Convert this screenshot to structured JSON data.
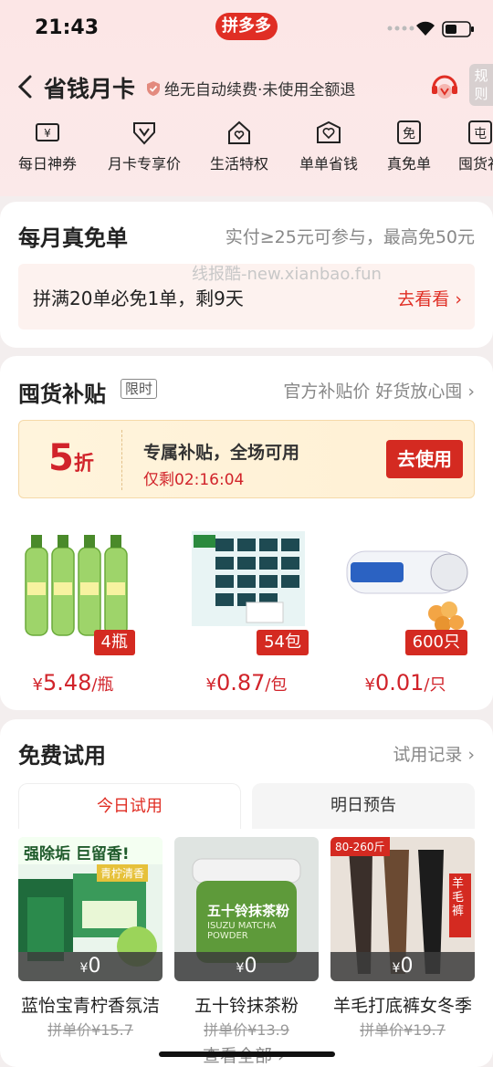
{
  "status": {
    "time": "21:43",
    "app_logo": "拼多多"
  },
  "topbar": {
    "title": "省钱月卡",
    "guarantee": "绝无自动续费·未使用全额退",
    "rules": "规则"
  },
  "benefits": [
    {
      "label": "每日神券",
      "icon": "yen-ticket-icon"
    },
    {
      "label": "月卡专享价",
      "icon": "v-shield-icon"
    },
    {
      "label": "生活特权",
      "icon": "house-heart-icon"
    },
    {
      "label": "单单省钱",
      "icon": "heart-box-icon"
    },
    {
      "label": "真免单",
      "icon": "free-icon",
      "icon_char": "免"
    },
    {
      "label": "囤货补",
      "icon": "stock-icon",
      "icon_char": "屯"
    }
  ],
  "free_order": {
    "title": "每月真免单",
    "rule": "实付≥25元可参与，最高免50元",
    "progress": "拼满20单必免1单，剩9天",
    "link": "去看看",
    "watermark": "线报酷-new.xianbao.fun"
  },
  "stock": {
    "title": "囤货补贴",
    "tag": "限时",
    "right": "官方补贴价 好货放心囤",
    "coupon": {
      "num": "5",
      "unit": "折",
      "title": "专属补贴，全场可用",
      "timer": "仅剩02:16:04",
      "button": "去使用"
    },
    "products": [
      {
        "badge": "4瓶",
        "yen": "¥",
        "price": "5.48",
        "unit": "/瓶"
      },
      {
        "badge": "54包",
        "yen": "¥",
        "price": "0.87",
        "unit": "/包"
      },
      {
        "badge": "600只",
        "yen": "¥",
        "price": "0.01",
        "unit": "/只"
      }
    ]
  },
  "trial": {
    "title": "免费试用",
    "record": "试用记录",
    "tabs": [
      "今日试用",
      "明日预告"
    ],
    "items": [
      {
        "name": "蓝怡宝青柠香氛洁",
        "yen": "¥",
        "zero": "0",
        "was": "拼单价¥15.7",
        "img_text": "强除垢 巨留香!",
        "img_sub": "青柠清香"
      },
      {
        "name": "五十铃抹茶粉",
        "yen": "¥",
        "zero": "0",
        "was": "拼单价¥13.9",
        "img_text": "五十铃抹茶粉",
        "img_sub": "ISUZU MATCHA POWDER"
      },
      {
        "name": "羊毛打底裤女冬季",
        "yen": "¥",
        "zero": "0",
        "was": "拼单价¥19.7",
        "img_text": "80-260斤",
        "img_sub": "羊毛裤"
      }
    ],
    "more": "查看全部"
  },
  "colors": {
    "accent": "#e02e24",
    "header_bg": "#fce6e6"
  }
}
